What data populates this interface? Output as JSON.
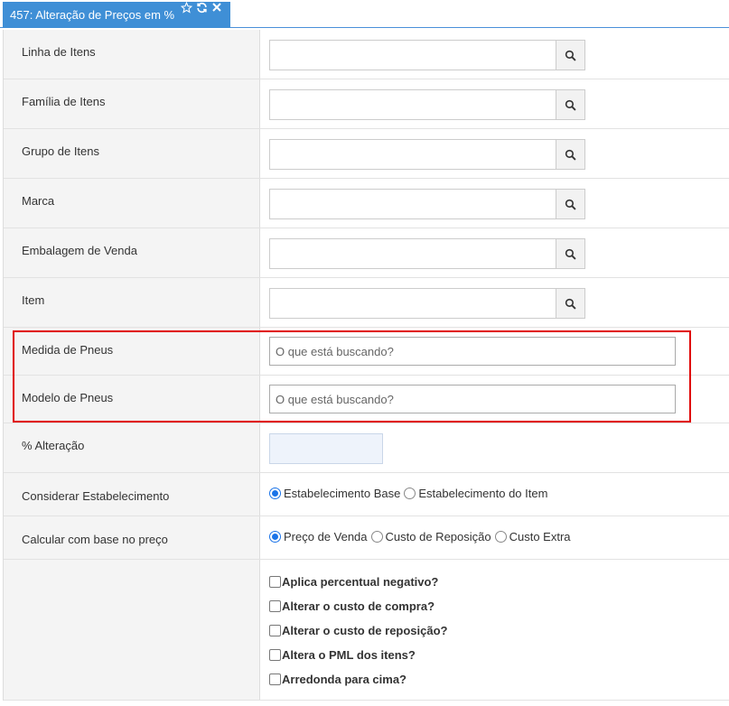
{
  "tab": {
    "title": "457: Alteração de Preços em %",
    "icons": [
      "star-icon",
      "refresh-icon",
      "close-icon"
    ]
  },
  "lookups": [
    {
      "label": "Linha de Itens"
    },
    {
      "label": "Família de Itens"
    },
    {
      "label": "Grupo de Itens"
    },
    {
      "label": "Marca"
    },
    {
      "label": "Embalagem de Venda"
    },
    {
      "label": "Item"
    }
  ],
  "search_fields": [
    {
      "label": "Medida de Pneus",
      "placeholder": "O que está buscando?"
    },
    {
      "label": "Modelo de Pneus",
      "placeholder": "O que está buscando?"
    }
  ],
  "percent": {
    "label": "% Alteração",
    "value": ""
  },
  "estabelecimento": {
    "label": "Considerar Estabelecimento",
    "options": [
      {
        "label": "Estabelecimento Base",
        "selected": true
      },
      {
        "label": "Estabelecimento do Item",
        "selected": false
      }
    ]
  },
  "base_preco": {
    "label": "Calcular com base no preço",
    "options": [
      {
        "label": "Preço de Venda",
        "selected": true
      },
      {
        "label": "Custo de Reposição",
        "selected": false
      },
      {
        "label": "Custo Extra",
        "selected": false
      }
    ]
  },
  "checkboxes": [
    {
      "label": "Aplica percentual negativo?",
      "checked": false
    },
    {
      "label": "Alterar o custo de compra?",
      "checked": false
    },
    {
      "label": "Alterar o custo de reposição?",
      "checked": false
    },
    {
      "label": "Altera o PML dos itens?",
      "checked": false
    },
    {
      "label": "Arredonda para cima?",
      "checked": false
    }
  ],
  "colors": {
    "tab_bg": "#3f8fd6",
    "highlight": "#e00000",
    "radio_selected": "#1a73e8"
  }
}
